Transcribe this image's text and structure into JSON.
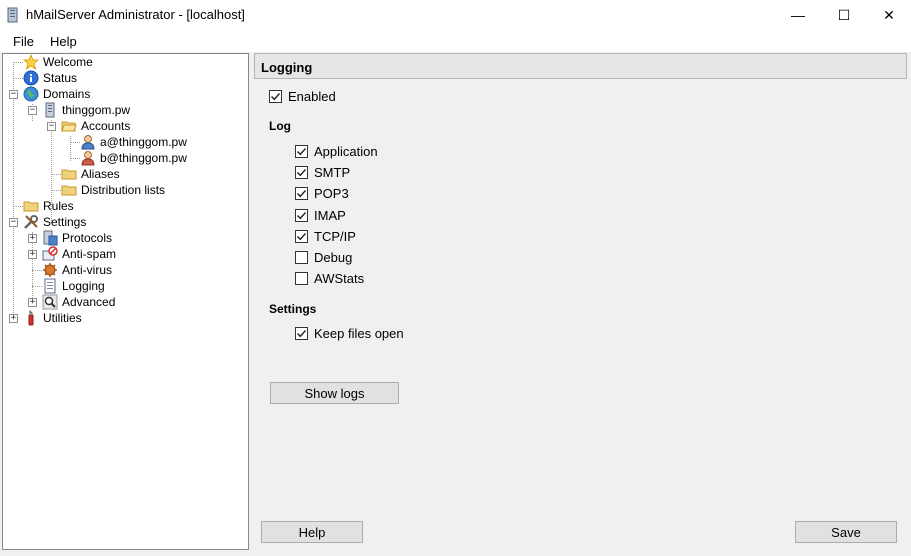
{
  "window": {
    "title": "hMailServer Administrator - [localhost]",
    "min_glyph": "—",
    "max_glyph": "☐",
    "close_glyph": "✕"
  },
  "menu": {
    "file": "File",
    "help": "Help"
  },
  "tree": {
    "welcome": "Welcome",
    "status": "Status",
    "domains": "Domains",
    "domain": "thinggom.pw",
    "accounts": "Accounts",
    "account_a": "a@thinggom.pw",
    "account_b": "b@thinggom.pw",
    "aliases": "Aliases",
    "distribution_lists": "Distribution lists",
    "rules": "Rules",
    "settings": "Settings",
    "protocols": "Protocols",
    "anti_spam": "Anti-spam",
    "anti_virus": "Anti-virus",
    "logging": "Logging",
    "advanced": "Advanced",
    "utilities": "Utilities"
  },
  "panel": {
    "header": "Logging",
    "enabled": {
      "label": "Enabled",
      "checked": true
    },
    "log_section": "Log",
    "log_items": [
      {
        "label": "Application",
        "checked": true
      },
      {
        "label": "SMTP",
        "checked": true
      },
      {
        "label": "POP3",
        "checked": true
      },
      {
        "label": "IMAP",
        "checked": true
      },
      {
        "label": "TCP/IP",
        "checked": true
      },
      {
        "label": "Debug",
        "checked": false
      },
      {
        "label": "AWStats",
        "checked": false
      }
    ],
    "settings_section": "Settings",
    "keep_files_open": {
      "label": "Keep files open",
      "checked": true
    },
    "show_logs": "Show logs",
    "help": "Help",
    "save": "Save"
  }
}
